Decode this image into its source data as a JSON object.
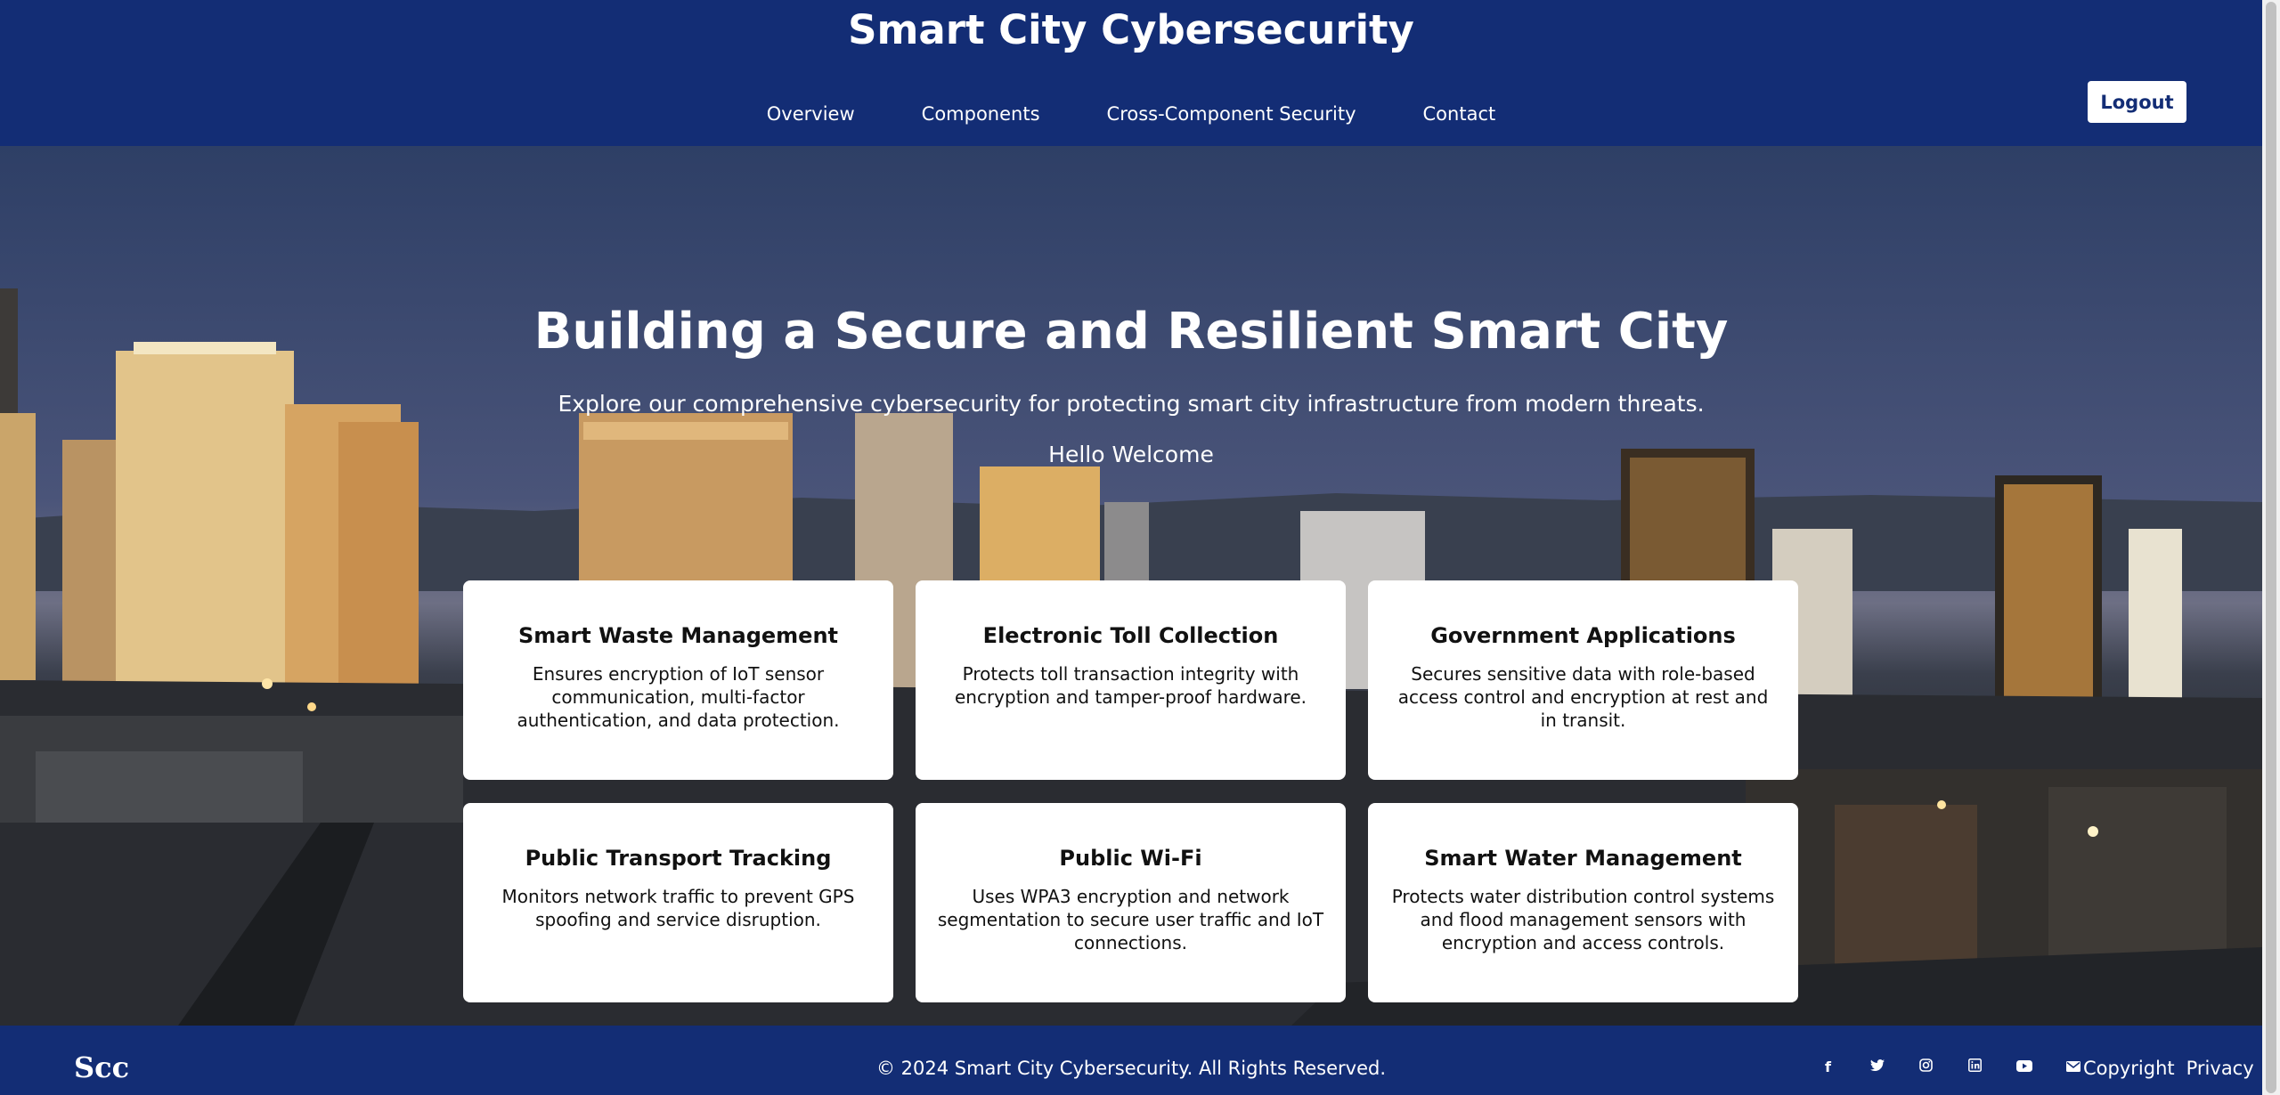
{
  "header": {
    "title": "Smart City Cybersecurity",
    "nav": [
      "Overview",
      "Components",
      "Cross-Component Security",
      "Contact"
    ],
    "logout_label": "Logout"
  },
  "hero": {
    "title": "Building a Secure and Resilient Smart City",
    "subtitle": "Explore our comprehensive cybersecurity for protecting smart city infrastructure from modern threats.",
    "greeting": "Hello Welcome"
  },
  "cards": [
    {
      "title": "Smart Waste Management",
      "text": "Ensures encryption of IoT sensor communication, multi-factor authentication, and data protection."
    },
    {
      "title": "Electronic Toll Collection",
      "text": "Protects toll transaction integrity with encryption and tamper-proof hardware."
    },
    {
      "title": "Government Applications",
      "text": "Secures sensitive data with role-based access control and encryption at rest and in transit."
    },
    {
      "title": "Public Transport Tracking",
      "text": "Monitors network traffic to prevent GPS spoofing and service disruption."
    },
    {
      "title": "Public Wi-Fi",
      "text": "Uses WPA3 encryption and network segmentation to secure user traffic and IoT connections."
    },
    {
      "title": "Smart Water Management",
      "text": "Protects water distribution control systems and flood management sensors with encryption and access controls."
    }
  ],
  "footer": {
    "logo": "Scc",
    "copyright": "© 2024 Smart City Cybersecurity. All Rights Reserved.",
    "social_icons": [
      "facebook-icon",
      "twitter-icon",
      "instagram-icon",
      "linkedin-icon",
      "youtube-icon",
      "email-icon"
    ],
    "links": [
      "Copyright",
      "Privacy"
    ]
  },
  "colors": {
    "brand": "#132d75",
    "card": "#ffffff",
    "text": "#111111"
  }
}
